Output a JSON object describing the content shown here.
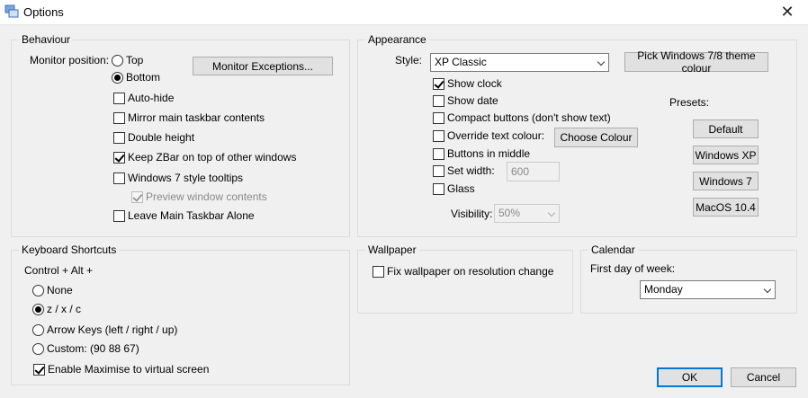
{
  "window": {
    "title": "Options",
    "close_glyph": "✕"
  },
  "behaviour": {
    "title": "Behaviour",
    "monitor_position_label": "Monitor position:",
    "pos_top": "Top",
    "pos_bottom": "Bottom",
    "selected_position": "Bottom",
    "monitor_exceptions_button": "Monitor Exceptions...",
    "auto_hide": "Auto-hide",
    "mirror": "Mirror main taskbar contents",
    "double_height": "Double height",
    "keep_on_top": "Keep ZBar on top of other windows",
    "win7_tooltips": "Windows 7 style tooltips",
    "preview_contents": "Preview window contents",
    "leave_alone": "Leave Main Taskbar Alone"
  },
  "appearance": {
    "title": "Appearance",
    "style_label": "Style:",
    "style_value": "XP Classic",
    "pick_colour_button": "Pick Windows 7/8 theme colour",
    "show_clock": "Show clock",
    "show_date": "Show date",
    "compact_buttons": "Compact buttons (don't show text)",
    "override_text": "Override text colour:",
    "choose_colour_button": "Choose Colour",
    "buttons_middle": "Buttons in middle",
    "set_width": "Set width:",
    "width_value": "600",
    "glass": "Glass",
    "visibility_label": "Visibility:",
    "visibility_value": "50%",
    "presets_label": "Presets:",
    "preset_default": "Default",
    "preset_xp": "Windows XP",
    "preset_7": "Windows 7",
    "preset_mac": "MacOS 10.4"
  },
  "keyboard": {
    "title": "Keyboard Shortcuts",
    "modifier_label": "Control + Alt +",
    "opt_none": "None",
    "opt_zxc": "z / x / c",
    "opt_arrows": "Arrow Keys (left / right / up)",
    "opt_custom": "Custom: (90 88 67)",
    "selected": "z / x / c",
    "enable_maximise": "Enable Maximise to virtual screen"
  },
  "wallpaper": {
    "title": "Wallpaper",
    "fix_wallpaper": "Fix wallpaper on resolution change"
  },
  "calendar": {
    "title": "Calendar",
    "first_day_label": "First day of week:",
    "first_day_value": "Monday"
  },
  "footer": {
    "ok": "OK",
    "cancel": "Cancel"
  },
  "colors": {
    "accent": "#0078d7",
    "window_bg": "#f0f0f0"
  }
}
